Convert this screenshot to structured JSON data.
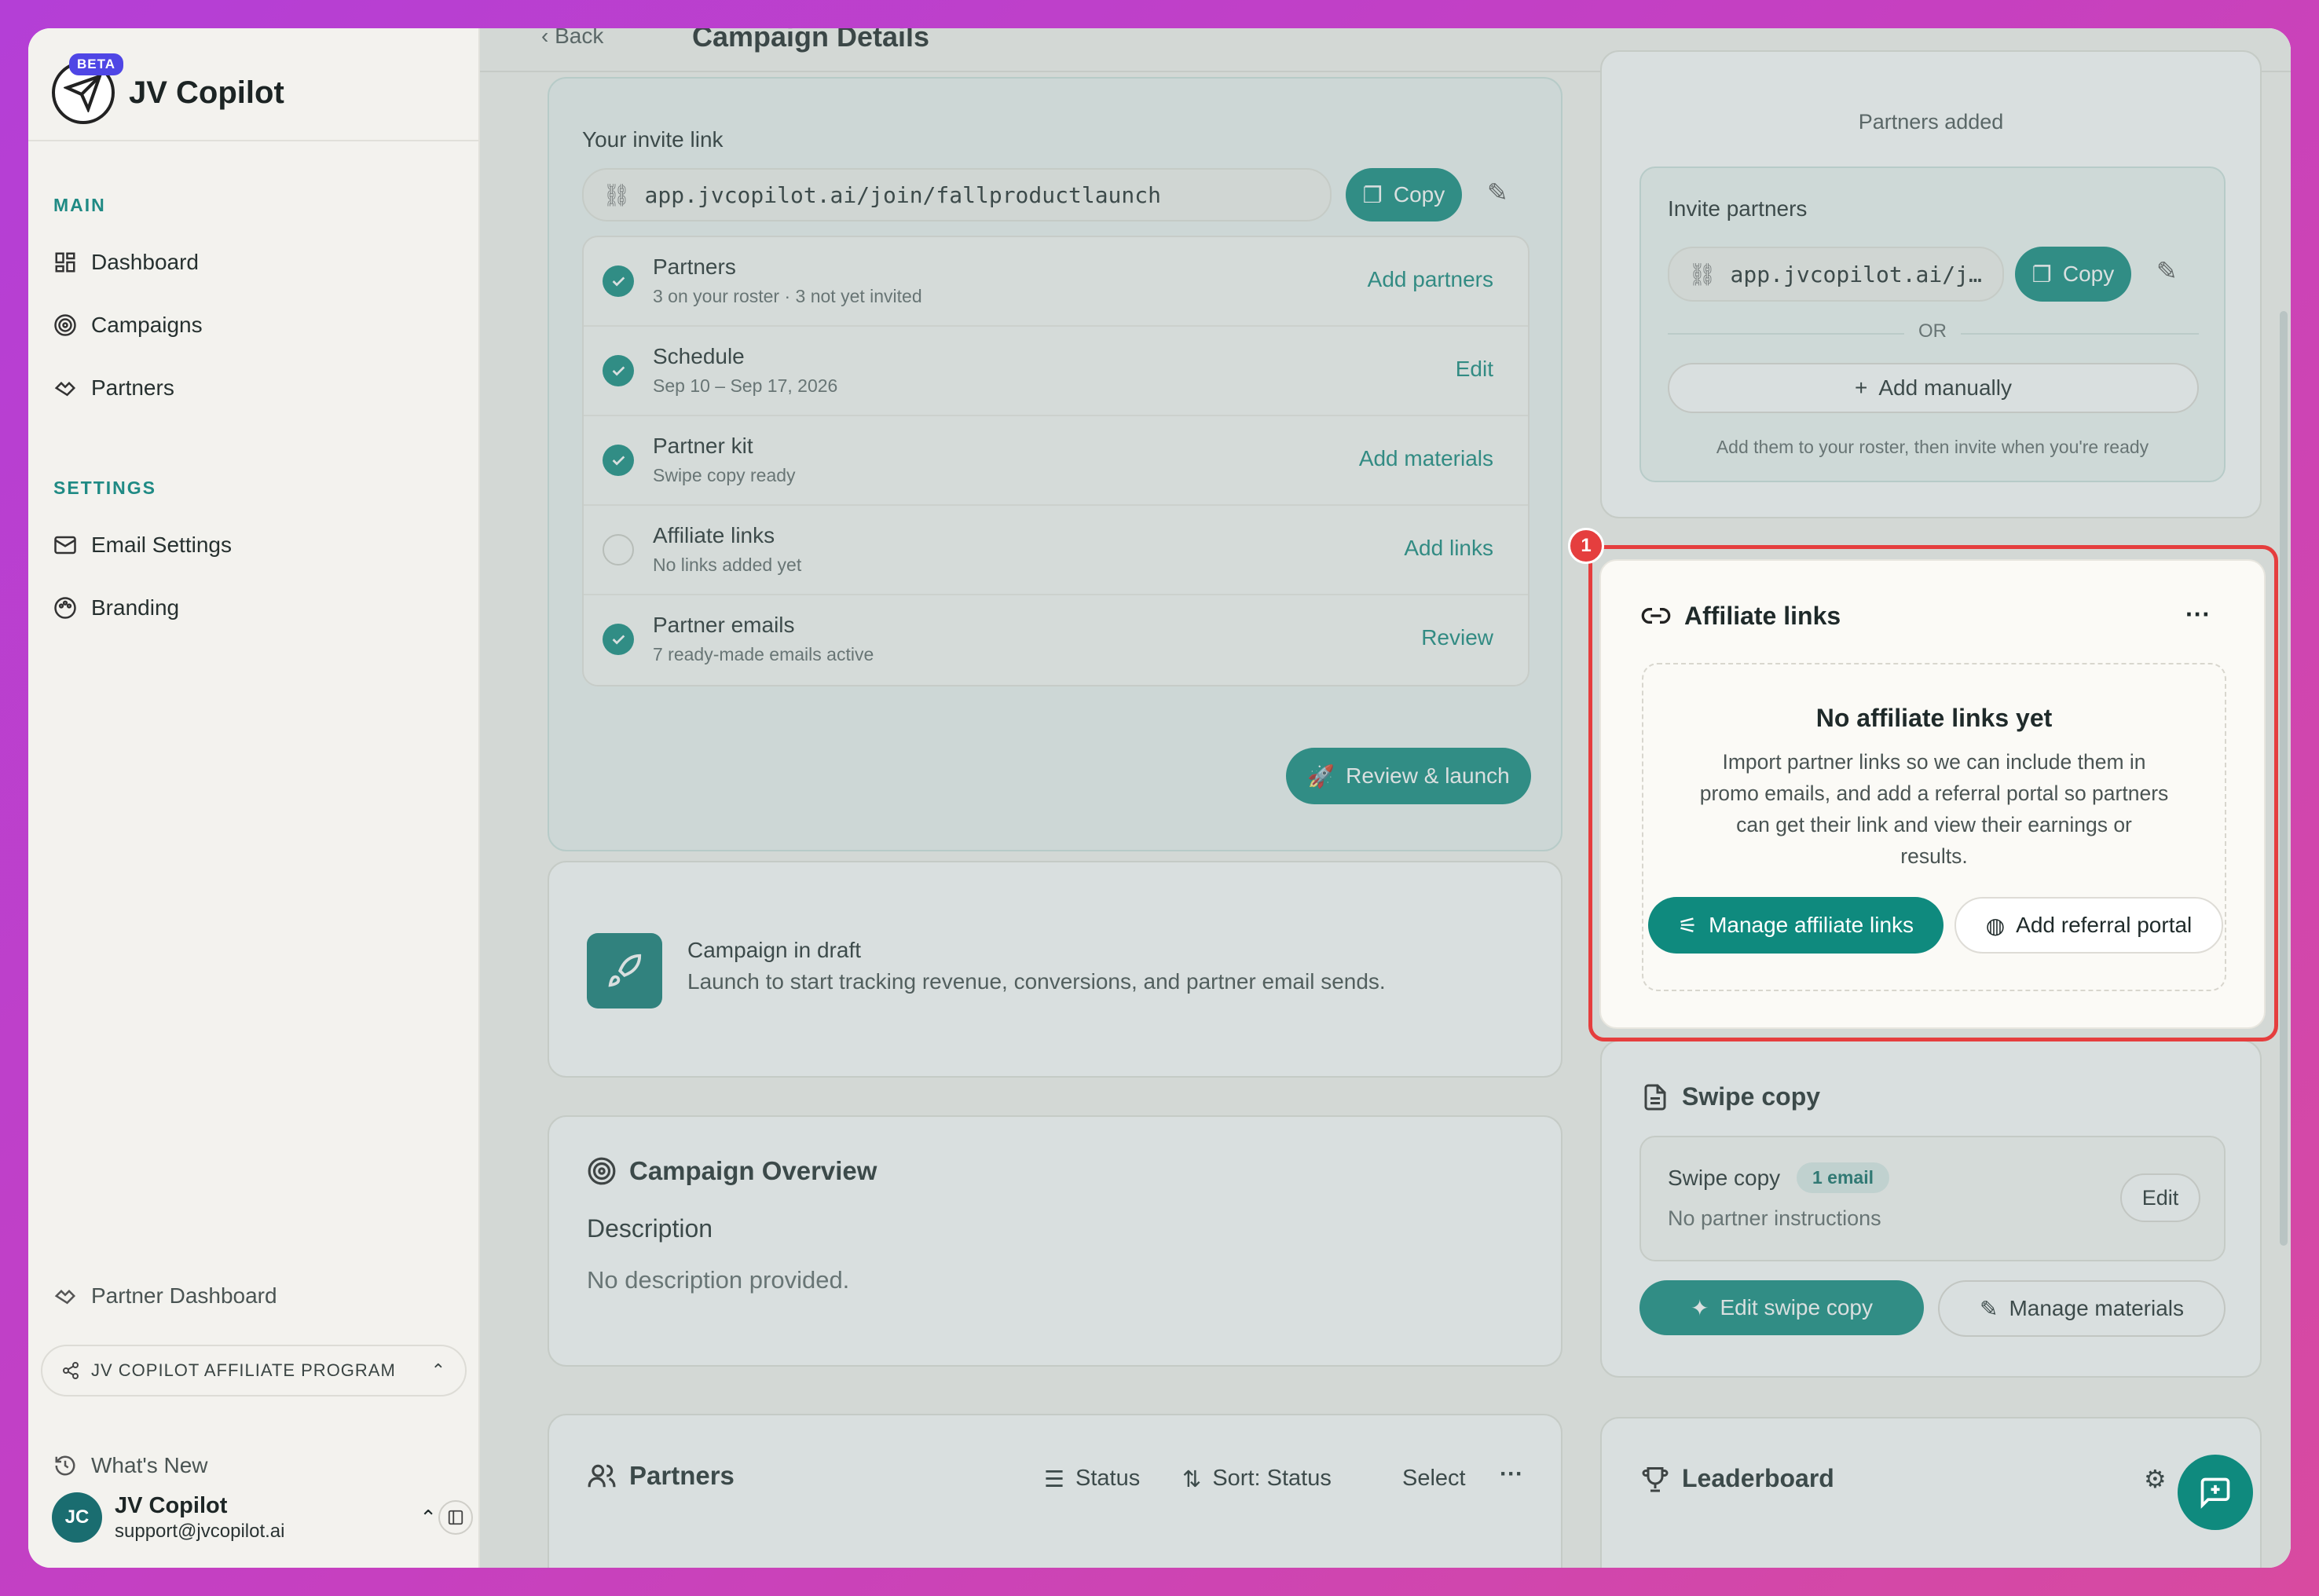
{
  "app": {
    "name": "JV Copilot",
    "badge": "BETA"
  },
  "sidebar": {
    "main_label": "MAIN",
    "main_items": [
      {
        "label": "Dashboard"
      },
      {
        "label": "Campaigns"
      },
      {
        "label": "Partners"
      }
    ],
    "settings_label": "SETTINGS",
    "settings_items": [
      {
        "label": "Email Settings"
      },
      {
        "label": "Branding"
      }
    ],
    "partner_dashboard": "Partner Dashboard",
    "affiliate_program": "JV COPILOT AFFILIATE PROGRAM",
    "whats_new": "What's New",
    "user": {
      "initials": "JC",
      "name": "JV Copilot",
      "email": "support@jvcopilot.ai"
    }
  },
  "header": {
    "back": "Back",
    "title": "Campaign Details"
  },
  "invite": {
    "label": "Your invite link",
    "link": "app.jvcopilot.ai/join/fallproductlaunch",
    "copy": "Copy"
  },
  "checklist": [
    {
      "title": "Partners",
      "sub": "3 on your roster · 3 not yet invited",
      "action": "Add partners",
      "done": true
    },
    {
      "title": "Schedule",
      "sub": "Sep 10 – Sep 17, 2026",
      "action": "Edit",
      "done": true
    },
    {
      "title": "Partner kit",
      "sub": "Swipe copy ready",
      "action": "Add materials",
      "done": true
    },
    {
      "title": "Affiliate links",
      "sub": "No links added yet",
      "action": "Add links",
      "done": false
    },
    {
      "title": "Partner emails",
      "sub": "7 ready-made emails active",
      "action": "Review",
      "done": true
    }
  ],
  "review_launch": "Review & launch",
  "draft": {
    "title": "Campaign in draft",
    "sub": "Launch to start tracking revenue, conversions, and partner email sends."
  },
  "overview": {
    "title": "Campaign Overview",
    "desc_label": "Description",
    "desc": "No description provided."
  },
  "partners_section": {
    "title": "Partners",
    "status": "Status",
    "sort": "Sort: Status",
    "select": "Select"
  },
  "right": {
    "partners_added": "Partners added",
    "invite_title": "Invite partners",
    "invite_link": "app.jvcopilot.ai/j…",
    "copy": "Copy",
    "or": "OR",
    "add_manually": "Add manually",
    "invite_hint": "Add them to your roster, then invite when you're ready"
  },
  "affiliate": {
    "title": "Affiliate links",
    "empty_title": "No affiliate links yet",
    "empty_lines": [
      "Import partner links so we can include them in",
      "promo emails, and add a referral portal so partners",
      "can get their link and view their earnings or",
      "results."
    ],
    "manage": "Manage affiliate links",
    "add_portal": "Add referral portal",
    "badge": "1"
  },
  "swipe": {
    "title": "Swipe copy",
    "item": "Swipe copy",
    "badge": "1 email",
    "sub": "No partner instructions",
    "edit": "Edit",
    "edit_swipe": "Edit swipe copy",
    "manage_materials": "Manage materials"
  },
  "leaderboard": {
    "title": "Leaderboard"
  },
  "colors": {
    "accent": "#0f8a7e",
    "highlight": "#e53e3e"
  }
}
